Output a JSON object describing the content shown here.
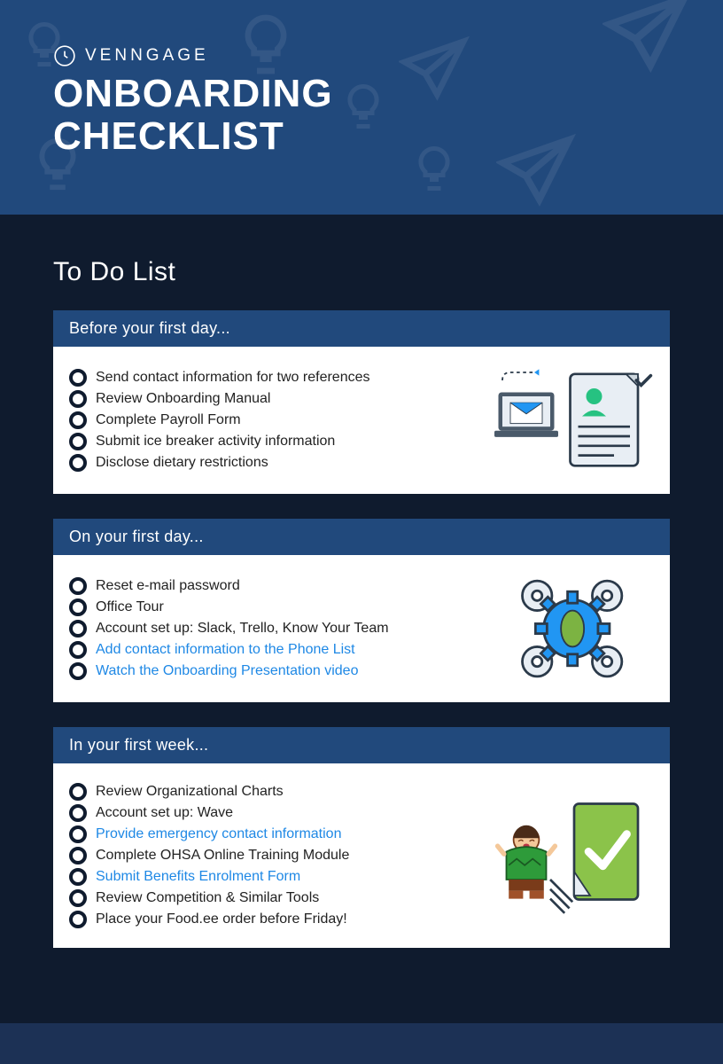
{
  "brand": {
    "name": "VENNGAGE"
  },
  "title_line1": "ONBOARDING",
  "title_line2": "CHECKLIST",
  "todo_heading": "To Do List",
  "sections": [
    {
      "heading": "Before your first day...",
      "items": [
        {
          "text": "Send contact information for two references",
          "link": false
        },
        {
          "text": "Review Onboarding Manual",
          "link": false
        },
        {
          "text": "Complete Payroll Form",
          "link": false
        },
        {
          "text": "Submit ice breaker activity information",
          "link": false
        },
        {
          "text": "Disclose dietary restrictions",
          "link": false
        }
      ]
    },
    {
      "heading": "On your first day...",
      "items": [
        {
          "text": "Reset e-mail password",
          "link": false
        },
        {
          "text": "Office Tour",
          "link": false
        },
        {
          "text": "Account set up: Slack, Trello, Know Your Team",
          "link": false
        },
        {
          "text": "Add contact information to the Phone List",
          "link": true
        },
        {
          "text": "Watch the Onboarding Presentation video",
          "link": true
        }
      ]
    },
    {
      "heading": "In your first week...",
      "items": [
        {
          "text": "Review Organizational Charts",
          "link": false
        },
        {
          "text": "Account set up: Wave",
          "link": false
        },
        {
          "text": "Provide emergency contact information",
          "link": true
        },
        {
          "text": "Complete OHSA Online Training Module",
          "link": false
        },
        {
          "text": "Submit Benefits Enrolment Form",
          "link": true
        },
        {
          "text": "Review Competition & Similar Tools",
          "link": false
        },
        {
          "text": "Place your Food.ee order before Friday!",
          "link": false
        }
      ]
    }
  ]
}
